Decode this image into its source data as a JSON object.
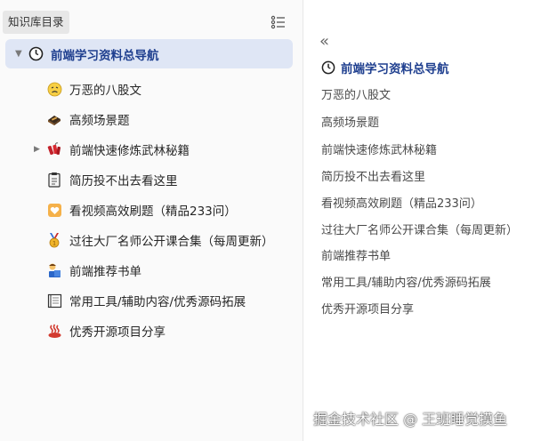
{
  "sidebar": {
    "title": "知识库目录",
    "root": {
      "label": "前端学习资料总导航",
      "icon": "clock-icon"
    },
    "items": [
      {
        "label": "万恶的八股文",
        "icon": "confounded-face-icon"
      },
      {
        "label": "高频场景题",
        "icon": "bento-box-icon"
      },
      {
        "label": "前端快速修炼武林秘籍",
        "icon": "firecracker-icon"
      },
      {
        "label": "简历投不出去看这里",
        "icon": "clipboard-icon"
      },
      {
        "label": "看视频高效刷题（精品233问）",
        "icon": "heart-box-icon"
      },
      {
        "label": "过往大厂名师公开课合集（每周更新）",
        "icon": "medal-icon"
      },
      {
        "label": "前端推荐书单",
        "icon": "reader-icon"
      },
      {
        "label": "常用工具/辅助内容/优秀源码拓展",
        "icon": "notebook-icon"
      },
      {
        "label": "优秀开源项目分享",
        "icon": "hot-springs-icon"
      }
    ]
  },
  "toc": {
    "collapse_label": "«",
    "title": "前端学习资料总导航",
    "items": [
      "万恶的八股文",
      "高频场景题",
      "前端快速修炼武林秘籍",
      "简历投不出去看这里",
      "看视频高效刷题（精品233问）",
      "过往大厂名师公开课合集（每周更新）",
      "前端推荐书单",
      "常用工具/辅助内容/优秀源码拓展",
      "优秀开源项目分享"
    ]
  },
  "watermark": "掘金技术社区 @ 王班睡觉摸鱼",
  "colors": {
    "accent": "#1f3f8f",
    "selected_bg": "#dfe6f5",
    "sidebar_bg": "#fafafa"
  }
}
